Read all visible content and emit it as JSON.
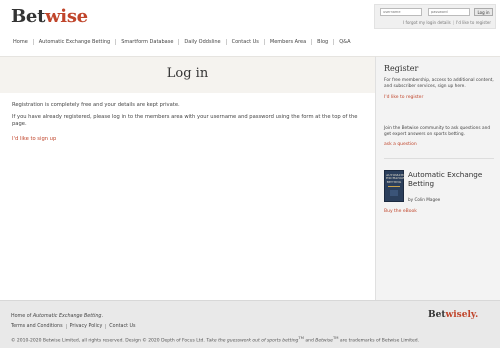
{
  "brand": {
    "bet": "Bet",
    "wise": "wise"
  },
  "login": {
    "username_placeholder": "username",
    "password_placeholder": "password",
    "button": "Log in",
    "forgot": "I forgot my login details",
    "register": "I'd like to register"
  },
  "nav": [
    "Home",
    "Automatic Exchange Betting",
    "Smartform Database",
    "Daily Oddsline",
    "Contact Us",
    "Members Area",
    "Blog",
    "Q&A"
  ],
  "page": {
    "title": "Log in",
    "para1": "Registration is completely free and your details are kept private.",
    "para2": "If you have already registered, please log in to the members area with your username and password using the form at the top of the page.",
    "signup_link": "I'd like to sign up"
  },
  "sidebar": {
    "register_title": "Register",
    "register_text": "For free membership, access to additional content, and subscriber services, sign up here.",
    "register_link": "I'd like to register",
    "community_text": "Join the Betwise community to ask questions and get expert answers on sports betting.",
    "community_link": "ask a question",
    "book_cover_lines": [
      "AUTOMATIC",
      "EXCHANGE",
      "BETTING"
    ],
    "book_title": "Automatic Exchange Betting",
    "book_author": "by Colin Magee",
    "book_link": "Buy the eBook"
  },
  "footer": {
    "home_prefix": "Home of ",
    "home_em": "Automatic Exchange Betting",
    "home_suffix": ".",
    "links": [
      "Terms and Conditions",
      "Privacy Policy",
      "Contact Us"
    ],
    "copy_prefix": "© 2010-2020 Betwise Limited, all rights reserved.   Design © 2020 Depth of Focus Ltd.   ",
    "copy_em1": "Take the guesswork out of sports betting",
    "copy_tm": "TM",
    "copy_and": " and ",
    "copy_em2": "Betwise",
    "copy_suffix": " are trademarks of Betwise Limited.",
    "logo_bet": "Bet",
    "logo_wise": "wisely."
  },
  "colors": {
    "accent": "#c0452b",
    "band": "#f5f3ef",
    "sidebar": "#f3f3f3",
    "footer": "#e9e9e9"
  }
}
